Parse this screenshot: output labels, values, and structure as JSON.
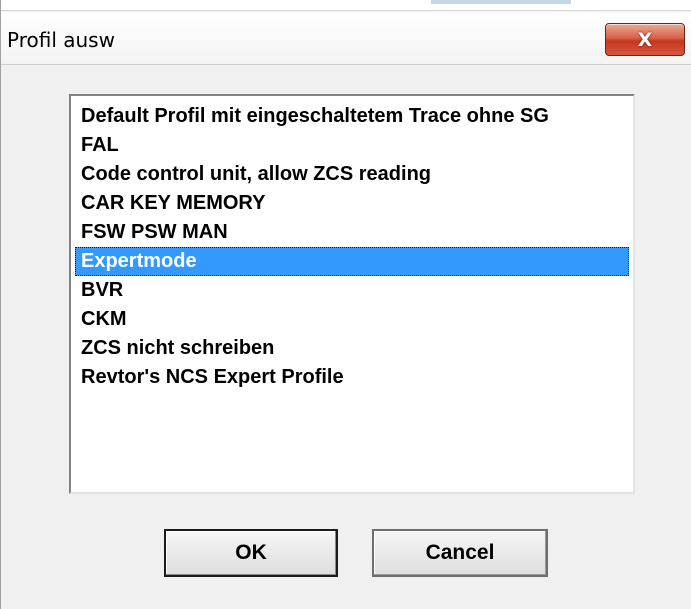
{
  "window": {
    "title": "Profil ausw",
    "close_glyph": "X",
    "close_icon": "close-icon"
  },
  "profile_list": {
    "items": [
      {
        "label": "Default Profil mit eingeschaltetem Trace ohne SG",
        "selected": false
      },
      {
        "label": "FAL",
        "selected": false
      },
      {
        "label": "Code control unit, allow ZCS reading",
        "selected": false
      },
      {
        "label": "CAR KEY MEMORY",
        "selected": false
      },
      {
        "label": "FSW PSW MAN",
        "selected": false
      },
      {
        "label": "Expertmode",
        "selected": true
      },
      {
        "label": "BVR",
        "selected": false
      },
      {
        "label": "CKM",
        "selected": false
      },
      {
        "label": "ZCS nicht schreiben",
        "selected": false
      },
      {
        "label": "Revtor's NCS Expert Profile",
        "selected": false
      }
    ],
    "selected_index": 5
  },
  "buttons": {
    "ok_label": "OK",
    "cancel_label": "Cancel"
  },
  "colors": {
    "selection": "#3399ff",
    "close_button": "#c5371f"
  }
}
